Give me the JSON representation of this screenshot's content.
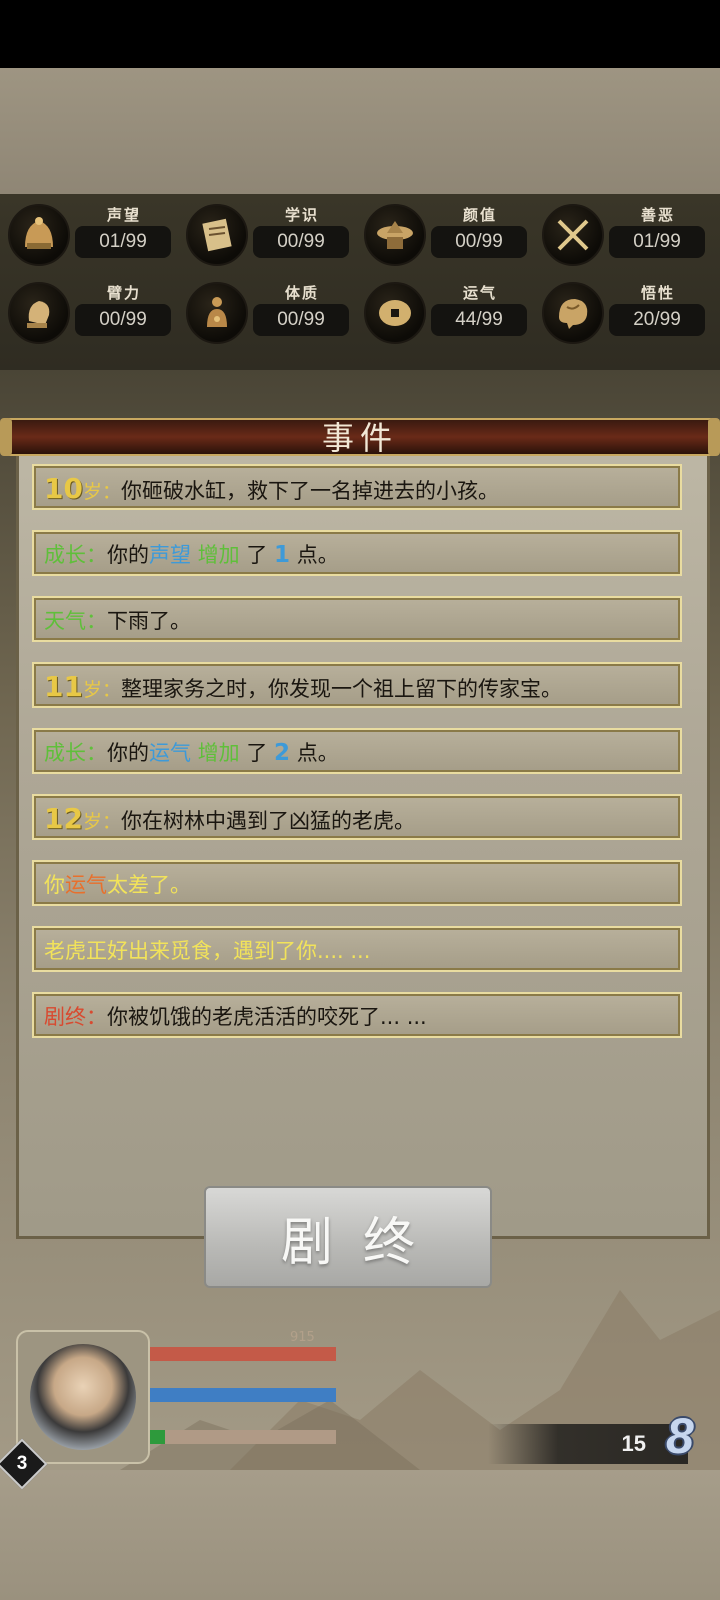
{
  "stats": [
    {
      "name": "声望",
      "value": "01/99",
      "icon": "helmet-icon"
    },
    {
      "name": "学识",
      "value": "00/99",
      "icon": "scroll-icon"
    },
    {
      "name": "颜值",
      "value": "00/99",
      "icon": "hat-icon"
    },
    {
      "name": "善恶",
      "value": "01/99",
      "icon": "crossed-swords-icon"
    },
    {
      "name": "臂力",
      "value": "00/99",
      "icon": "fist-icon"
    },
    {
      "name": "体质",
      "value": "00/99",
      "icon": "body-icon"
    },
    {
      "name": "运气",
      "value": "44/99",
      "icon": "coin-icon"
    },
    {
      "name": "悟性",
      "value": "20/99",
      "icon": "brain-icon"
    }
  ],
  "panel": {
    "title": "事件"
  },
  "events": [
    {
      "age": "10",
      "age_suffix": "岁：",
      "text": "你砸破水缸，救下了一名掉进去的小孩。"
    },
    {
      "tag": "成长：",
      "prefix": "你的",
      "stat": "声望",
      "verb": " 增加",
      "mid": " 了 ",
      "amount": "1",
      "suffix": " 点。"
    },
    {
      "tag": "天气：",
      "text": "下雨了。"
    },
    {
      "age": "11",
      "age_suffix": "岁：",
      "text": "整理家务之时，你发现一个祖上留下的传家宝。"
    },
    {
      "tag": "成长：",
      "prefix": "你的",
      "stat": "运气",
      "verb": " 增加",
      "mid": " 了 ",
      "amount": "2",
      "suffix": " 点。"
    },
    {
      "age": "12",
      "age_suffix": "岁：",
      "text": "你在树林中遇到了凶猛的老虎。"
    },
    {
      "pre": "你",
      "stat": "运气",
      "post": "太差了。"
    },
    {
      "text": "老虎正好出来觅食，遇到了你.... ..."
    },
    {
      "tag": "剧终：",
      "text": "你被饥饿的老虎活活的咬死了... ..."
    }
  ],
  "end_button": "剧终",
  "player": {
    "level": "3",
    "hp_text": "915"
  },
  "counter": "15",
  "speed": "8",
  "colors": {
    "age": "#e8c846",
    "green": "#5fbf3a",
    "blue": "#3e9ad8",
    "red": "#d84a30"
  }
}
